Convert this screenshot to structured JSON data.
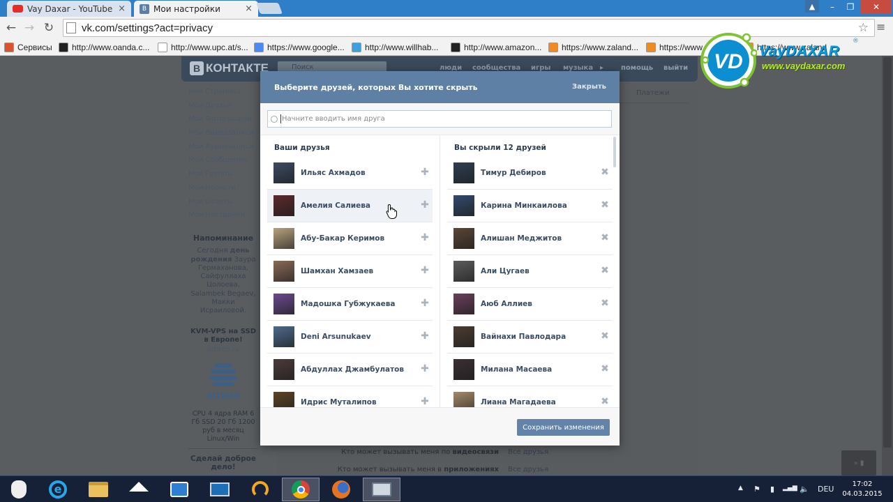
{
  "browser": {
    "tabs": [
      {
        "title": "Vay Daxar - YouTube",
        "close": "×"
      },
      {
        "title": "Мои настройки",
        "close": "×"
      }
    ],
    "window_controls": {
      "user": "▲",
      "minimize": "–",
      "maximize": "❐",
      "close": "✕"
    },
    "nav": {
      "back": "←",
      "forward": "→",
      "reload": "↻"
    },
    "url": "vk.com/settings?act=privacy",
    "star": "☆",
    "menu": "≡",
    "bookmarks": [
      {
        "label": "Сервисы",
        "icon": "apps-grid-icon",
        "color": "#d9532c"
      },
      {
        "label": "http://www.oanda.c...",
        "icon": "oanda-icon",
        "color": "#222222"
      },
      {
        "label": "http://www.upc.at/s...",
        "icon": "page-icon",
        "color": "#ffffff"
      },
      {
        "label": "https://www.google...",
        "icon": "google-icon",
        "color": "#4a8af4"
      },
      {
        "label": "http://www.willhab...",
        "icon": "willhaben-icon",
        "color": "#3aa2e0"
      },
      {
        "label": "http://www.amazon...",
        "icon": "amazon-icon",
        "color": "#222222"
      },
      {
        "label": "https://www.zaland...",
        "icon": "zalando-icon",
        "color": "#f18a21"
      },
      {
        "label": "https://www",
        "icon": "zalando-icon",
        "color": "#f18a21"
      },
      {
        "label": "https://www.zaland",
        "icon": "zalando-icon",
        "color": "#f18a21"
      }
    ]
  },
  "vk": {
    "logo_letter": "В",
    "logo_text": "КОНТАКТЕ",
    "search_placeholder": "Поиск",
    "nav": [
      "люди",
      "сообщества",
      "игры",
      "музыка",
      "помощь",
      "выйти"
    ],
    "nav_arrow": "▸",
    "menu": [
      "Моя Страница",
      "Мои Друзья",
      "Мои Фотографии",
      "Мои Видеозаписи",
      "Мои Аудиозаписи",
      "Мои Сообщения",
      "Мои Группы",
      "Мои Новости",
      "Мои Ответы",
      "Мои Настройки"
    ],
    "reminder": {
      "title": "Напоминание",
      "line1_a": "Сегодня ",
      "line1_b": "день рождения",
      "rest": "Заура Гермаханова, Сайфуллаха Цолоева, Salambek Begaev, Макки Исраиловой."
    },
    "ad": {
      "title": "KVM-VPS на SSD в Европе!",
      "site": "bitweb.ru",
      "brand": "BITWEB",
      "text": "CPU 4 ядра RAM 6 Гб SSD 20 Гб 1200 руб в месяц Linux/Win"
    },
    "good_deed": "Сделай доброе дело!",
    "right_tab": "Платежи",
    "settings_rows": [
      {
        "a": "Кто может вызывать меня по ",
        "b": "видеосвязи",
        "value": "Все друзья"
      },
      {
        "a": "Кто может вызывать меня в ",
        "b": "приложениях",
        "value": "Все друзья"
      }
    ]
  },
  "modal": {
    "title": "Выберите друзей, которых Вы хотите скрыть",
    "close": "Закрыть",
    "search_placeholder": "Начните вводить имя друга",
    "left_title": "Ваши друзья",
    "right_title": "Вы скрыли 12 друзей",
    "add_symbol": "✚",
    "remove_symbol": "✖",
    "save": "Сохранить изменения",
    "friends": [
      {
        "name": "Ильяс Ахмадов",
        "avatar": "#3d4b63"
      },
      {
        "name": "Амелия Салиева",
        "avatar": "#5a2a2e"
      },
      {
        "name": "Абу-Бакар Керимов",
        "avatar": "#b7a27f"
      },
      {
        "name": "Шамхан Хамзаев",
        "avatar": "#8a6a57"
      },
      {
        "name": "Мадошка Губжукаева",
        "avatar": "#6b4a8e"
      },
      {
        "name": "Deni Arsunukaev",
        "avatar": "#4d6a8a"
      },
      {
        "name": "Абдуллах Джамбулатов",
        "avatar": "#4b3b3b"
      },
      {
        "name": "Идрис Муталипов",
        "avatar": "#5c4426"
      }
    ],
    "hidden": [
      {
        "name": "Тимур Дебиров",
        "avatar": "#2f3f52"
      },
      {
        "name": "Карина Минкаилова",
        "avatar": "#334a6b"
      },
      {
        "name": "Алишан Меджитов",
        "avatar": "#5a4636"
      },
      {
        "name": "Али Цугаев",
        "avatar": "#5c5c5c"
      },
      {
        "name": "Аюб Аллиев",
        "avatar": "#6a3f5a"
      },
      {
        "name": "Вайнахи Павлодара",
        "avatar": "#4a3d33"
      },
      {
        "name": "Милана Масаева",
        "avatar": "#3b2f33"
      },
      {
        "name": "Лиана Магадаева",
        "avatar": "#a58a6a"
      }
    ]
  },
  "watermark": {
    "letters": "VD",
    "title": "VayDAXAR",
    "reg": "®",
    "url": "www.vaydaxar.com"
  },
  "taskbar": {
    "apps": [
      {
        "icon": "anonymous-mask-icon",
        "active": false
      },
      {
        "icon": "internet-explorer-icon",
        "active": false
      },
      {
        "icon": "file-explorer-icon",
        "active": false
      },
      {
        "icon": "home-icon",
        "active": false
      },
      {
        "icon": "mail-icon",
        "active": false
      },
      {
        "icon": "monitor-icon",
        "active": false
      },
      {
        "icon": "headphones-icon",
        "active": false
      },
      {
        "icon": "chrome-icon",
        "active": true
      },
      {
        "icon": "firefox-icon",
        "active": false
      },
      {
        "icon": "remote-desktop-icon",
        "active": true
      }
    ],
    "tray": {
      "arrow": "▲",
      "flag": "⚑",
      "battery": "▮",
      "signal": "▂▄▆",
      "volume": "🔈",
      "lang": "DEU"
    },
    "time": "17:02",
    "date": "04.03.2015",
    "corner": "» ▮"
  }
}
